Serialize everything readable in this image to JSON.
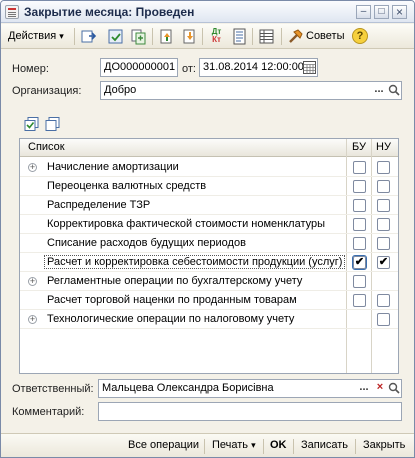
{
  "window": {
    "title": "Закрытие месяца: Проведен",
    "minimize_glyph": "–",
    "maximize_glyph": "□",
    "close_glyph": "×"
  },
  "toolbar": {
    "actions_label": "Действия",
    "actions_arrow": "▾",
    "dt_kt_label": "ДтКт",
    "advice_label": "Советы",
    "help_glyph": "?"
  },
  "form": {
    "number_label": "Номер:",
    "number_value": "ДО000000001",
    "from_label": "от:",
    "date_value": "31.08.2014 12:00:00",
    "organization_label": "Организация:",
    "organization_value": "Добро",
    "responsible_label": "Ответственный:",
    "responsible_value": "Мальцева Олександра Борисівна",
    "comment_label": "Комментарий:",
    "comment_value": "",
    "ellipsis": "...",
    "clear_glyph": "×"
  },
  "grid": {
    "col_list": "Список",
    "col_bu": "БУ",
    "col_nu": "НУ",
    "check_glyph": "✔",
    "expand_glyph": "+",
    "rows": [
      {
        "label": "Начисление амортизации",
        "expandable": true,
        "bu": false,
        "nu": false
      },
      {
        "label": "Переоценка валютных средств",
        "expandable": false,
        "bu": false,
        "nu": false
      },
      {
        "label": "Распределение ТЗР",
        "expandable": false,
        "bu": false,
        "nu": false
      },
      {
        "label": "Корректировка фактической стоимости номенклатуры",
        "expandable": false,
        "bu": false,
        "nu": false
      },
      {
        "label": "Списание расходов будущих периодов",
        "expandable": false,
        "bu": false,
        "nu": false
      },
      {
        "label": "Расчет и корректировка себестоимости продукции (услуг)",
        "expandable": false,
        "bu": true,
        "nu": true
      },
      {
        "label": "Регламентные операции по бухгалтерскому учету",
        "expandable": true,
        "bu": false,
        "nu": null
      },
      {
        "label": "Расчет торговой наценки по проданным товарам",
        "expandable": false,
        "bu": false,
        "nu": false
      },
      {
        "label": "Технологические операции по налоговому учету",
        "expandable": true,
        "bu": null,
        "nu": false
      }
    ]
  },
  "bottom": {
    "all_operations": "Все операции",
    "print": "Печать",
    "print_arrow": "▾",
    "ok": "OK",
    "save": "Записать",
    "close": "Закрыть"
  },
  "colors": {
    "window_bg": "#f4f1e8",
    "title_text": "#1d2c4c",
    "accent_orange": "#e8952a",
    "accent_blue": "#3a6fb0"
  }
}
